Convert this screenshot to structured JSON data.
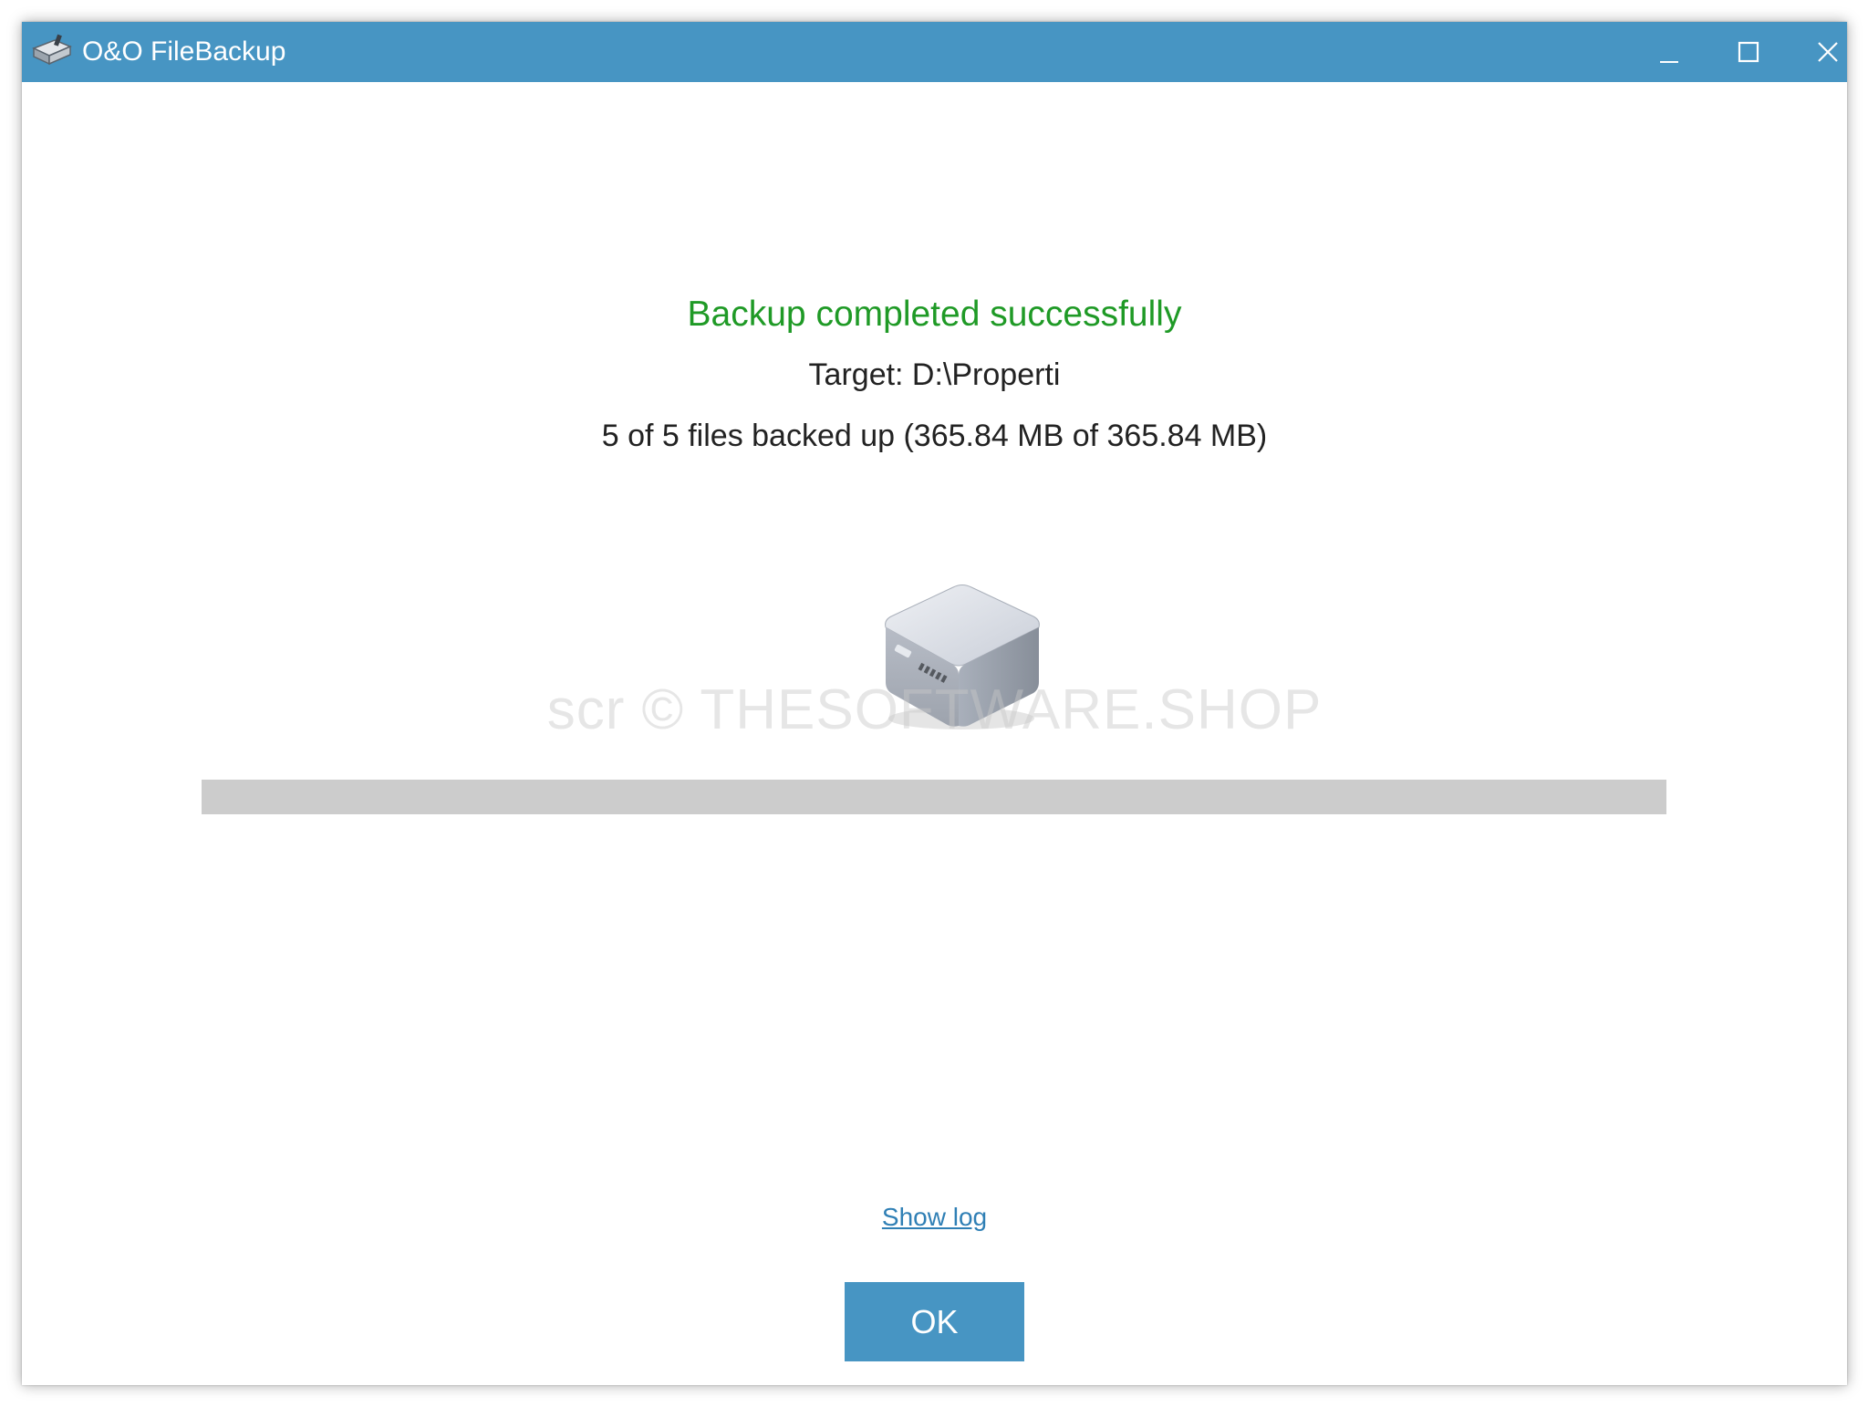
{
  "window": {
    "title": "O&O FileBackup",
    "titlebar_color": "#4795c3",
    "controls": {
      "minimize_icon": "minimize-icon",
      "maximize_icon": "maximize-icon",
      "close_icon": "close-icon"
    }
  },
  "status": {
    "title": "Backup completed successfully",
    "title_color": "#1f9a26",
    "target": "Target: D:\\Properti",
    "files_summary": "5 of 5 files backed up (365.84 MB of 365.84 MB)"
  },
  "illustration": {
    "icon": "drive-box-icon"
  },
  "watermark": "scr © THESOFTWARE.SHOP",
  "progress": {
    "fraction": 1.0,
    "color": "#cccccc"
  },
  "actions": {
    "show_log": "Show log",
    "ok": "OK",
    "button_color": "#4795c3"
  }
}
